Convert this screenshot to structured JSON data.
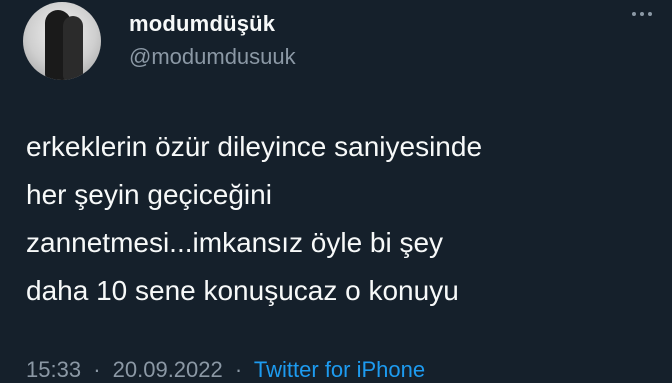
{
  "tweet": {
    "display_name": "modumdüşük",
    "handle": "@modumdusuuk",
    "text_lines": [
      "erkeklerin özür dileyince saniyesinde",
      "her şeyin geçiceğini",
      "zannetmesi...imkansız öyle bi şey",
      "daha 10 sene konuşucaz o konuyu"
    ],
    "time": "15:33",
    "date": "20.09.2022",
    "separator": "·",
    "source": "Twitter for iPhone"
  },
  "icons": {
    "more": "more-dots-icon",
    "avatar": "profile-photo"
  },
  "colors": {
    "background": "#15202b",
    "text": "#f7f9f9",
    "muted": "#8b98a5",
    "link": "#1d9bf0"
  }
}
